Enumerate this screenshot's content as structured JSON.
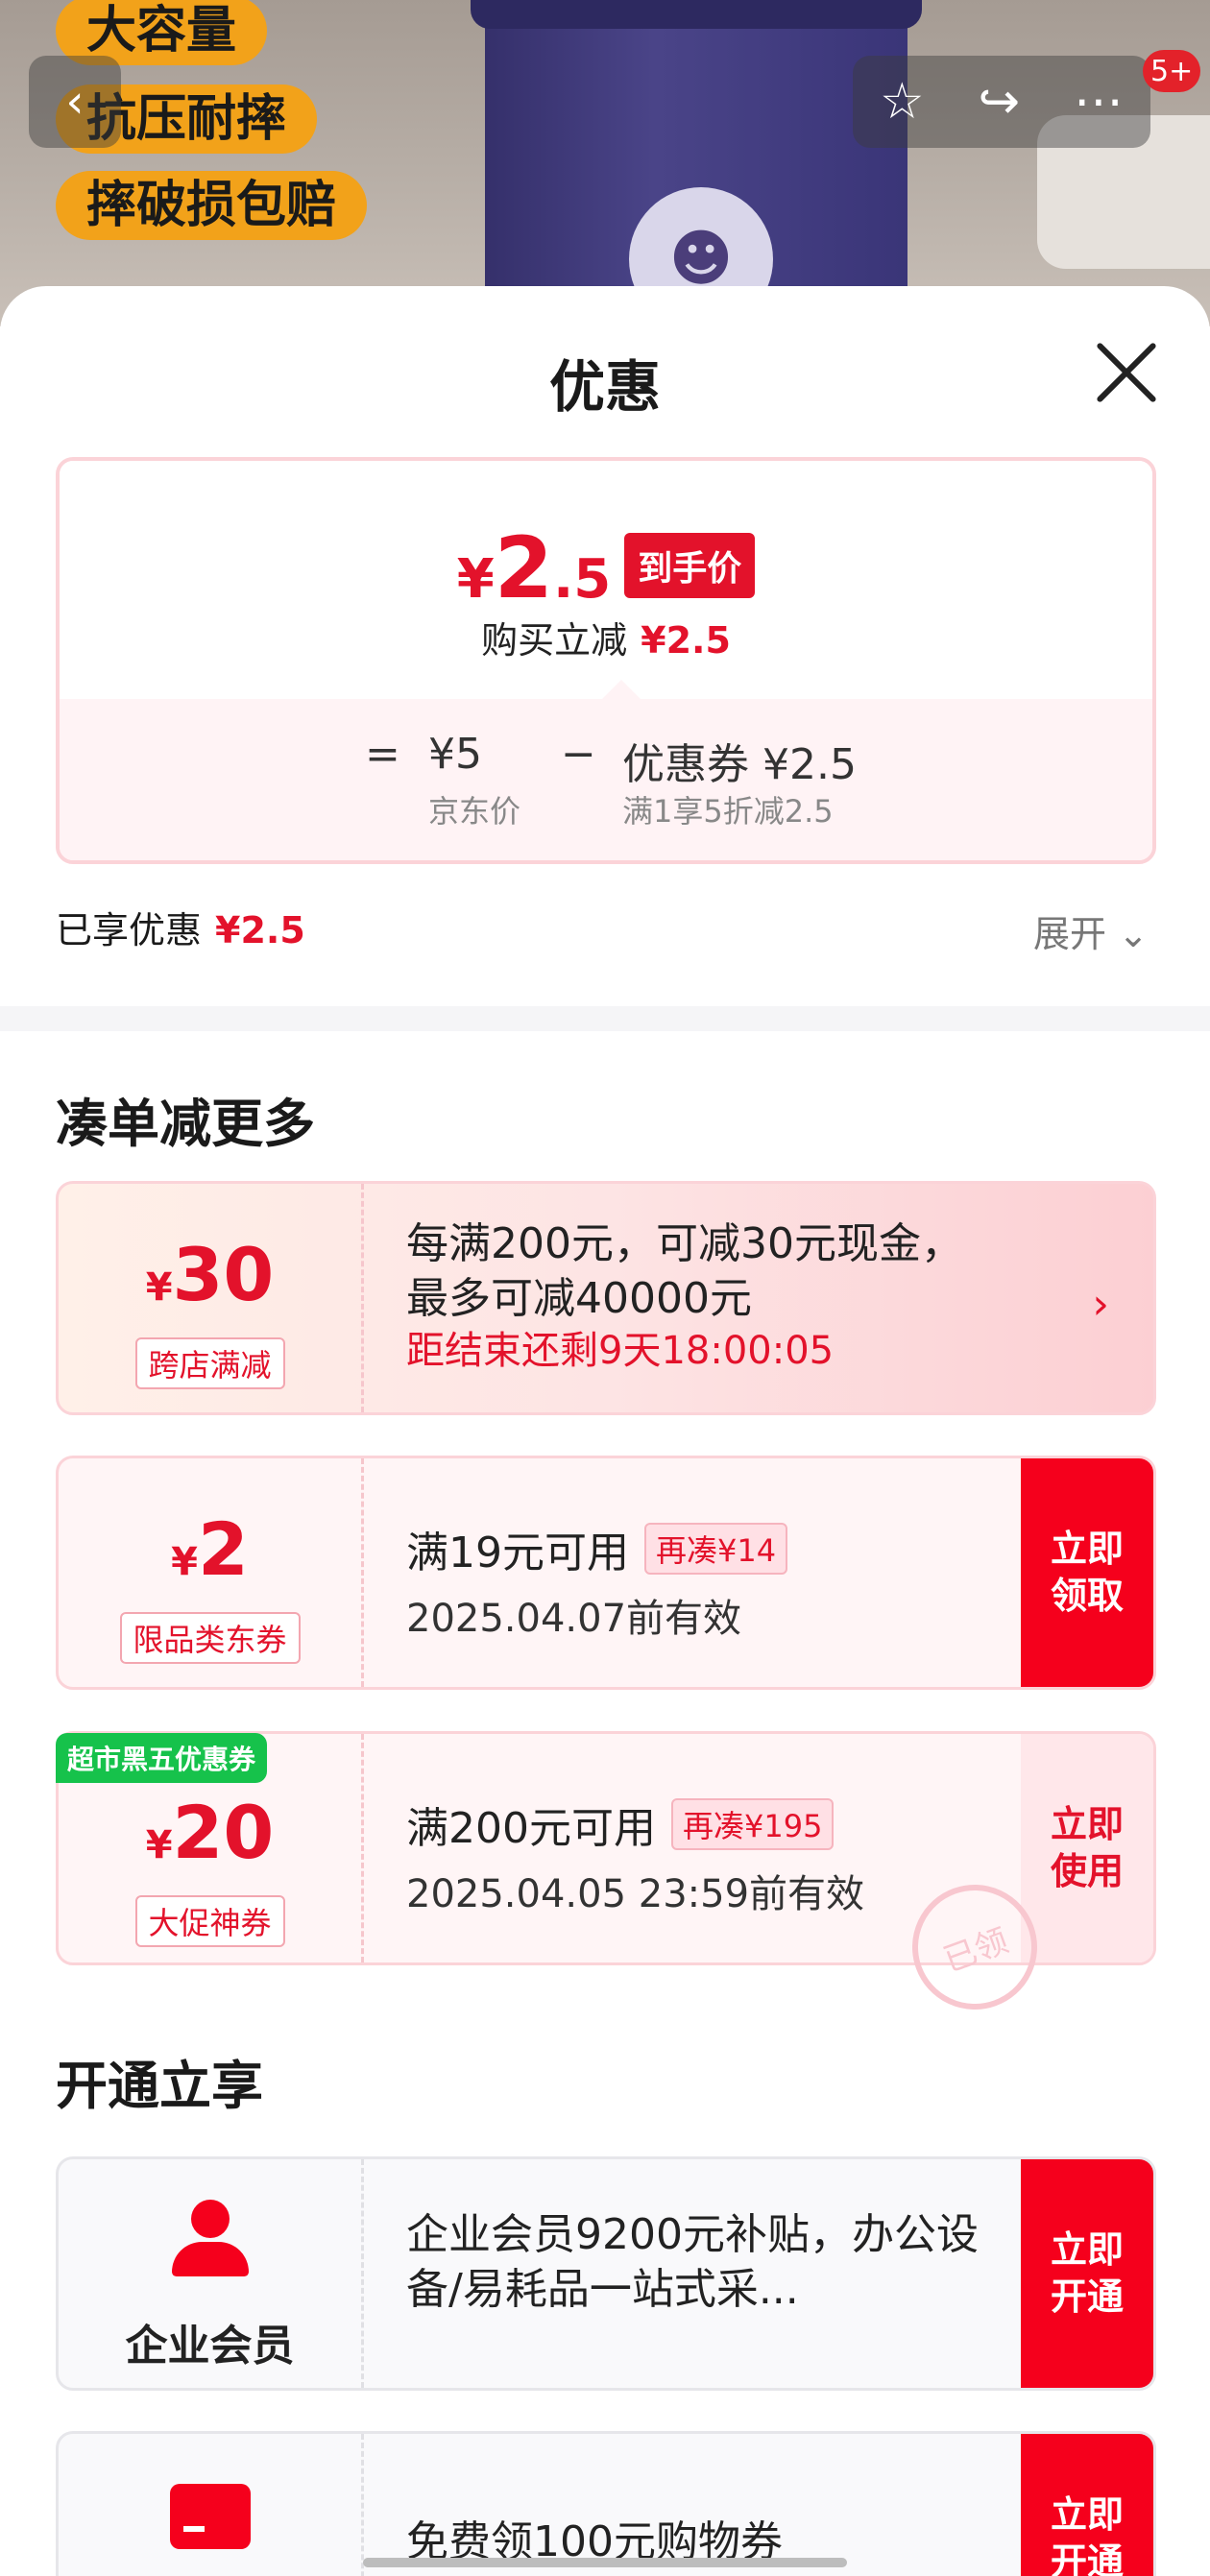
{
  "product_bg": {
    "tags": [
      "大容量",
      "抗压耐摔",
      "摔破损包赔"
    ],
    "badge_count": "5+"
  },
  "sheet": {
    "title": "优惠"
  },
  "price": {
    "currency": "¥",
    "integer": "2",
    "decimal": ".5",
    "hand_price_label": "到手价",
    "sub_label": "购买立减",
    "sub_value": "¥2.5",
    "eq": "=",
    "jd_price": "¥5",
    "jd_price_label": "京东价",
    "minus": "−",
    "coupon": "优惠券 ¥2.5",
    "coupon_desc": "满1享5折减2.5"
  },
  "enjoyed": {
    "label": "已享优惠",
    "value": "¥2.5",
    "expand": "展开"
  },
  "section_more": {
    "title": "凑单减更多",
    "cards": [
      {
        "currency": "¥",
        "amount": "30",
        "type": "跨店满减",
        "line1": "每满200元，可减30元现金，",
        "line2": "最多可减40000元",
        "line3": "距结束还剩9天18:00:05"
      },
      {
        "currency": "¥",
        "amount": "2",
        "type": "限品类东券",
        "line1": "满19元可用",
        "chip": "再凑¥14",
        "line2": "2025.04.07前有效",
        "button": "立即领取"
      },
      {
        "currency": "¥",
        "amount": "20",
        "type": "大促神券",
        "tag": "超市黑五优惠券",
        "line1": "满200元可用",
        "chip": "再凑¥195",
        "line2": "2025.04.05 23:59前有效",
        "button": "立即使用",
        "stamp": "已领"
      }
    ]
  },
  "section_open": {
    "title": "开通立享",
    "cards": [
      {
        "label": "企业会员",
        "desc": "企业会员9200元补贴，办公设备/易耗品一站式采...",
        "button": "立即开通"
      },
      {
        "desc": "免费领100元购物券",
        "button": "立即开通"
      }
    ]
  }
}
